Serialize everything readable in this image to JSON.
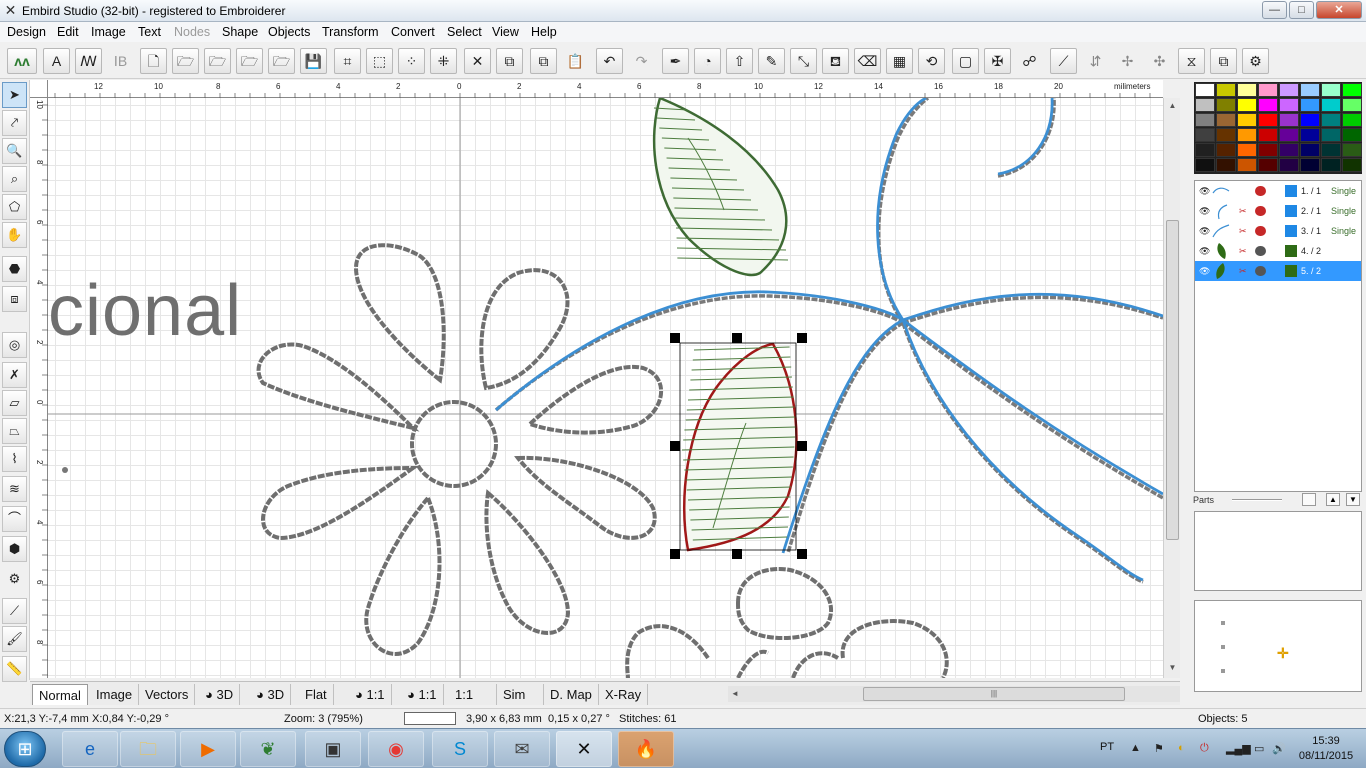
{
  "window": {
    "title": "Embird Studio (32-bit)  - registered to Embroiderer",
    "min_glyph": "—",
    "max_glyph": "□",
    "close_glyph": "✕"
  },
  "menu": {
    "items": [
      "Design",
      "Edit",
      "Image",
      "Text",
      "Nodes",
      "Shape",
      "Objects",
      "Transform",
      "Convert",
      "Select",
      "View",
      "Help"
    ],
    "disabled": [
      "Nodes"
    ]
  },
  "rulers": {
    "unit": "milimeters",
    "h_labels": [
      "12",
      "10",
      "8",
      "6",
      "4",
      "2",
      "0",
      "2",
      "4",
      "6",
      "8",
      "10",
      "12",
      "14",
      "16",
      "18",
      "20"
    ],
    "v_labels": [
      "10",
      "8",
      "6",
      "4",
      "2",
      "0",
      "2",
      "4",
      "6",
      "8"
    ]
  },
  "canvas": {
    "background_text": "cional"
  },
  "view_tabs": [
    "Normal",
    "Image",
    "Vectors",
    "3D",
    "3D",
    "Flat",
    "1:1",
    "1:1",
    "1:1",
    "Sim",
    "D. Map",
    "X-Ray"
  ],
  "active_view_tab": "Normal",
  "status": {
    "cursor": "X:21,3  Y:-7,4 mm",
    "offset": "X:0,84  Y:-0,29 °",
    "zoom": "Zoom: 3 (795%)",
    "size": "3,90 x 6,83 mm",
    "rotation": "0,15 x 0,27 °",
    "stitches": "Stitches: 61",
    "objects_count": "Objects: 5"
  },
  "palette": {
    "colors": [
      "#ffffff",
      "#c8c800",
      "#ffff99",
      "#ff99cc",
      "#cc99ff",
      "#99ccff",
      "#99ffcc",
      "#00ff00",
      "#c0c0c0",
      "#808000",
      "#ffff00",
      "#ff00ff",
      "#cc66ff",
      "#3399ff",
      "#00cccc",
      "#66ff66",
      "#808080",
      "#996633",
      "#ffcc00",
      "#ff0000",
      "#9933cc",
      "#0000ff",
      "#008080",
      "#00cc00",
      "#404040",
      "#663300",
      "#ff9900",
      "#cc0000",
      "#660099",
      "#000099",
      "#006666",
      "#006600",
      "#202020",
      "#552200",
      "#ff6600",
      "#800000",
      "#330066",
      "#000066",
      "#003333",
      "#2a5c16",
      "#101010",
      "#331100",
      "#cc5500",
      "#550000",
      "#220044",
      "#000033",
      "#002222",
      "#113300"
    ]
  },
  "objects": [
    {
      "number": "1.  / 1",
      "mode": "Single",
      "color": "#1e88e5",
      "selected": false
    },
    {
      "number": "2.  / 1",
      "mode": "Single",
      "color": "#1e88e5",
      "selected": false
    },
    {
      "number": "3.  / 1",
      "mode": "Single",
      "color": "#1e88e5",
      "selected": false
    },
    {
      "number": "4.  / 2",
      "mode": "",
      "color": "#2e6b16",
      "selected": false
    },
    {
      "number": "5.  / 2",
      "mode": "",
      "color": "#2e6b16",
      "selected": true
    }
  ],
  "parts": {
    "label": "Parts"
  },
  "taskbar": {
    "language": "PT",
    "time": "15:39",
    "date": "08/11/2015"
  },
  "colors": {
    "accent": "#3399ff",
    "stroke_blue": "#3c8fd3",
    "stroke_green": "#3e6b34",
    "stroke_red": "#a01818",
    "outline_gray": "#6f6f6f"
  }
}
